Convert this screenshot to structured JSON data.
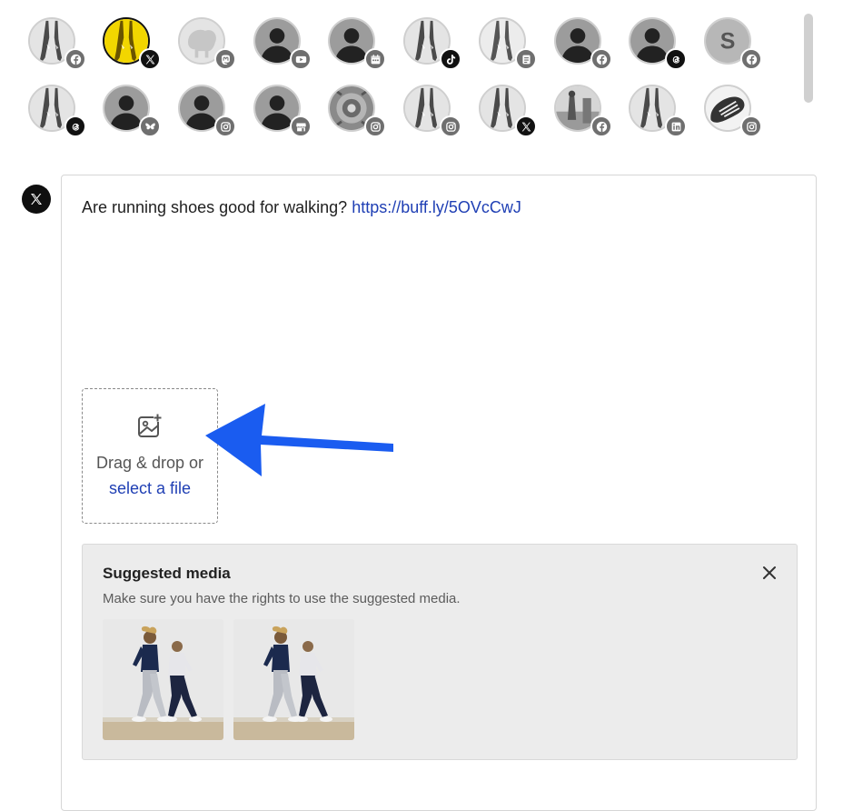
{
  "accounts": [
    {
      "avatar": "photo",
      "network": "facebook-icon",
      "badge_style": "grey",
      "selected": false
    },
    {
      "avatar": "yellow-photo",
      "network": "x-icon",
      "badge_style": "dark",
      "selected": true
    },
    {
      "avatar": "faded",
      "network": "mastodon-icon",
      "badge_style": "grey",
      "selected": false
    },
    {
      "avatar": "default",
      "network": "youtube-icon",
      "badge_style": "grey",
      "selected": false
    },
    {
      "avatar": "default",
      "network": "calendar-icon",
      "badge_style": "grey",
      "selected": false
    },
    {
      "avatar": "photo",
      "network": "tiktok-icon",
      "badge_style": "dark",
      "selected": false
    },
    {
      "avatar": "photo-ring",
      "network": "document-icon",
      "badge_style": "grey",
      "selected": false
    },
    {
      "avatar": "default",
      "network": "facebook-icon",
      "badge_style": "grey",
      "selected": false
    },
    {
      "avatar": "default",
      "network": "threads-icon",
      "badge_style": "dark",
      "selected": false
    },
    {
      "avatar": "letter",
      "letter": "S",
      "network": "facebook-icon",
      "badge_style": "grey",
      "selected": false
    },
    {
      "avatar": "photo",
      "network": "threads-icon",
      "badge_style": "dark",
      "selected": false
    },
    {
      "avatar": "default",
      "network": "bluesky-icon",
      "badge_style": "grey",
      "selected": false
    },
    {
      "avatar": "default",
      "network": "instagram-icon",
      "badge_style": "grey",
      "selected": false
    },
    {
      "avatar": "default",
      "network": "store-icon",
      "badge_style": "grey",
      "selected": false
    },
    {
      "avatar": "flower",
      "network": "instagram-icon",
      "badge_style": "grey",
      "selected": false
    },
    {
      "avatar": "photo",
      "network": "instagram-icon",
      "badge_style": "grey",
      "selected": false
    },
    {
      "avatar": "photo",
      "network": "x-icon",
      "badge_style": "dark",
      "selected": false
    },
    {
      "avatar": "photo-scene",
      "network": "facebook-icon",
      "badge_style": "grey",
      "selected": false
    },
    {
      "avatar": "photo",
      "network": "linkedin-icon",
      "badge_style": "grey",
      "selected": false
    },
    {
      "avatar": "shoe",
      "network": "instagram-icon",
      "badge_style": "grey",
      "selected": false
    }
  ],
  "composer": {
    "network_icon": "x-icon",
    "text": "Are running shoes good for walking? ",
    "link": "https://buff.ly/5OVcCwJ"
  },
  "upload": {
    "icon": "image-add-icon",
    "line1": "Drag & drop or",
    "line2": "select a file"
  },
  "suggested": {
    "title": "Suggested media",
    "subtitle": "Make sure you have the rights to use the suggested media.",
    "close_icon": "close-icon",
    "thumbnails": [
      "walking-women-photo",
      "walking-women-photo"
    ]
  },
  "colors": {
    "link": "#1f3fb4",
    "arrow": "#1a5cf0",
    "panel_bg": "#ececec",
    "selected_avatar": "#f2d600"
  }
}
